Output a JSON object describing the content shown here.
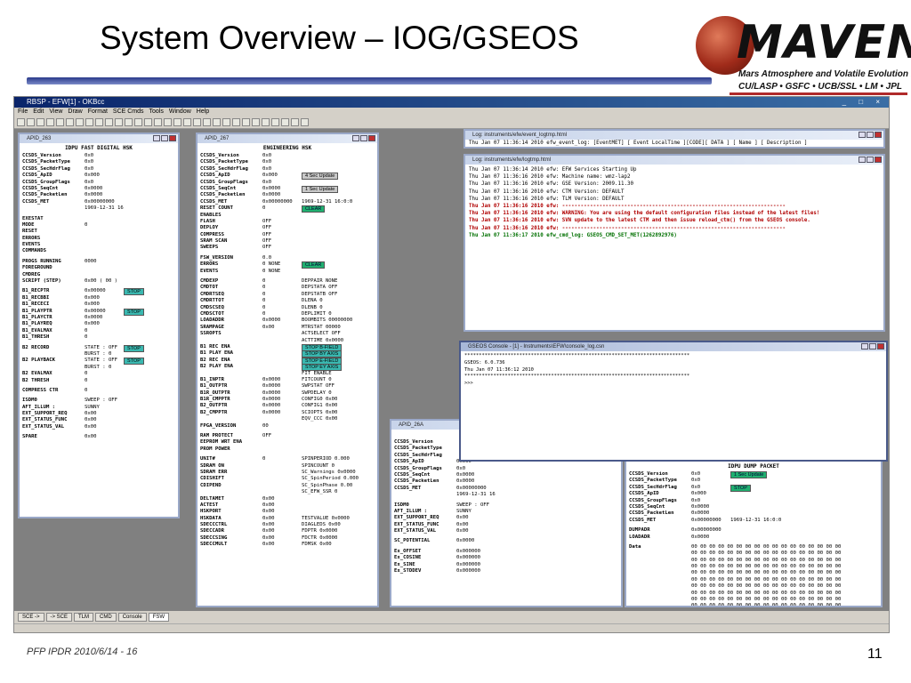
{
  "slide": {
    "title": "System Overview – IOG/GSEOS",
    "footer": "PFP IPDR 2010/6/14 - 16",
    "page_number": "11",
    "logo": {
      "word": "MAVEN",
      "subtitle": "Mars Atmosphere and Volatile Evolution Mission",
      "partners": "CU/LASP • GSFC • UCB/SSL • LM • JPL"
    }
  },
  "app": {
    "title": "RBSP - EFW[1] - OKBcc",
    "window_controls": "_ □ ×",
    "menu": [
      "File",
      "Edit",
      "View",
      "Draw",
      "Format",
      "SCE Cmds",
      "Tools",
      "Window",
      "Help"
    ],
    "toolbar_count": 30,
    "tasks": [
      "SCE ->",
      "-> SCE",
      "TLM",
      "CMD",
      "Console",
      "FSW"
    ],
    "active_task": "FSW"
  },
  "apid263": {
    "title": "APID_263",
    "header": "IDPU FAST DIGITAL HSK",
    "ccsds": [
      {
        "label": "CCSDS_Version",
        "value": "0x0"
      },
      {
        "label": "CCSDS_PacketType",
        "value": "0x0"
      },
      {
        "label": "CCSDS_SecHdrFlag",
        "value": "0x0"
      },
      {
        "label": "CCSDS_ApID",
        "value": "0x000"
      },
      {
        "label": "CCSDS_GroupFlags",
        "value": "0x0"
      },
      {
        "label": "CCSDS_SeqCnt",
        "value": "0x0000"
      },
      {
        "label": "CCSDS_PacketLen",
        "value": "0x0000"
      },
      {
        "label": "CCSDS_MET",
        "value": "0x00000000"
      }
    ],
    "met_time": "1969-12-31 16:0:0",
    "exestat_label": "EXESTAT",
    "exestat": [
      {
        "label": "MODE",
        "value": "0"
      },
      {
        "label": "RESET",
        "value": ""
      },
      {
        "label": "ERRORS",
        "value": ""
      },
      {
        "label": "EVENTS",
        "value": ""
      },
      {
        "label": "COMMANDS",
        "value": ""
      }
    ],
    "progs": [
      {
        "label": "PROGS RUNNING",
        "value": "0000"
      },
      {
        "label": "FOREGROUND",
        "value": ""
      },
      {
        "label": "CMDREG",
        "value": ""
      },
      {
        "label": "SCRIPT (STEP)",
        "value": "0x00 ( 00 )"
      }
    ],
    "b1": [
      {
        "label": "B1_RECPTR",
        "value": "0x00000",
        "btn": "STOP"
      },
      {
        "label": "B1_RECBBI",
        "value": "0x000",
        "btn": ""
      },
      {
        "label": "B1_RECECI",
        "value": "0x000",
        "btn": ""
      },
      {
        "label": "B1_PLAYPTR",
        "value": "0x00000",
        "btn": "STOP"
      },
      {
        "label": "B1_PLAYCTR",
        "value": "0x0000",
        "btn": ""
      },
      {
        "label": "B1_PLAYREQ",
        "value": "0x000",
        "btn": ""
      },
      {
        "label": "B1_EVALMAX",
        "value": "0",
        "btn": ""
      },
      {
        "label": "B1_THRESH",
        "value": "0",
        "btn": ""
      }
    ],
    "b2_record": {
      "label": "B2 RECORD",
      "state": "STATE : OFF",
      "burst": "BURST : 0",
      "btn": "STOP"
    },
    "b2_playback": {
      "label": "B2 PLAYBACK",
      "state": "STATE : OFF",
      "burst": "BURST : 0",
      "btn": "STOP"
    },
    "b2_other": [
      {
        "label": "B2 EVALMAX",
        "value": "0"
      },
      {
        "label": "B2 THRESH",
        "value": "0"
      }
    ],
    "compress_ctr": {
      "label": "COMPRESS CTR",
      "value": "0"
    },
    "isdm": [
      {
        "label": "ISDM0",
        "sub": "SWEEP :",
        "value": "OFF"
      },
      {
        "label": "",
        "sub": "AFT_ILLUM :",
        "value": "SUNNY"
      },
      {
        "label": "EXT_SUPPORT_REQ",
        "sub": "",
        "value": "0x00"
      },
      {
        "label": "EXT_STATUS_FUNC",
        "sub": "",
        "value": "0x00"
      },
      {
        "label": "EXT_STATUS_VAL",
        "sub": "",
        "value": "0x00"
      }
    ],
    "spare": {
      "label": "SPARE",
      "value": "0x00"
    }
  },
  "apid267": {
    "title": "APID_267",
    "header": "ENGINEERING HSK",
    "ccsds": [
      {
        "label": "CCSDS_Version",
        "value": "0x0",
        "btn": ""
      },
      {
        "label": "CCSDS_PacketType",
        "value": "0x0",
        "btn": ""
      },
      {
        "label": "CCSDS_SecHdrFlag",
        "value": "0x0",
        "btn": ""
      },
      {
        "label": "CCSDS_ApID",
        "value": "0x000",
        "btn": "4 Sec Update"
      },
      {
        "label": "CCSDS_GroupFlags",
        "value": "0x0",
        "btn": ""
      },
      {
        "label": "CCSDS_SeqCnt",
        "value": "0x0000",
        "btn": "1 Sec Update"
      },
      {
        "label": "CCSDS_PacketLen",
        "value": "0x0000",
        "btn": ""
      },
      {
        "label": "CCSDS_MET",
        "value": "0x00000000",
        "btn": "1969-12-31 16:0:0"
      }
    ],
    "reset_count": {
      "label": "RESET COUNT",
      "value": "0",
      "btn": "CLEAR"
    },
    "enables_label": "ENABLES",
    "enables": [
      {
        "label": "FLASH",
        "value": "OFF"
      },
      {
        "label": "DEPLOY",
        "value": "OFF"
      },
      {
        "label": "COMPRESS",
        "value": "OFF"
      },
      {
        "label": "SRAM SCAN",
        "value": "OFF"
      },
      {
        "label": "SWEEPS",
        "value": "OFF"
      }
    ],
    "fsw_version": {
      "label": "FSW_VERSION",
      "value": "0.0"
    },
    "errors": {
      "label": "ERRORS",
      "value": "0 NONE",
      "extra": "0x0000",
      "btn": "CLEAR"
    },
    "events": {
      "label": "EVENTS",
      "value": "0 NONE"
    },
    "left_list": [
      {
        "label": "CMDEXP",
        "value": "0"
      },
      {
        "label": "CMDTOT",
        "value": "0"
      },
      {
        "label": "CMDRTSEQ",
        "value": "0"
      },
      {
        "label": "CMDRTTOT",
        "value": "0"
      },
      {
        "label": "CMDSCSEQ",
        "value": "0"
      },
      {
        "label": "CMDSCTOT",
        "value": "0"
      },
      {
        "label": "LOADADDR",
        "value": "0x0000"
      },
      {
        "label": "SRAMPAGE",
        "value": "0x00"
      },
      {
        "label": "SSROPTS",
        "value": ""
      }
    ],
    "right_list": [
      {
        "label": "DEPPAIR",
        "value": "NONE"
      },
      {
        "label": "DEPSTATA",
        "value": "OFF"
      },
      {
        "label": "DEPSTATB",
        "value": "OFF"
      },
      {
        "label": "DLENA",
        "value": "0"
      },
      {
        "label": "DLENB",
        "value": "0"
      },
      {
        "label": "DEPLIMIT",
        "value": "0"
      },
      {
        "label": "BOOMBITS",
        "value": "00000000"
      },
      {
        "label": "MTRSTAT",
        "value": "00000"
      },
      {
        "label": "ACTSELECT",
        "value": "OFF"
      },
      {
        "label": "ACTTIME",
        "value": "0x0000"
      }
    ],
    "ssropts": [
      {
        "label": "B1 REC ENA",
        "value": "STOP"
      },
      {
        "label": "B1 PLAY ENA",
        "value": "STOP"
      },
      {
        "label": "B2 REC ENA",
        "value": "STOP"
      },
      {
        "label": "B2 PLAY ENA",
        "value": "STOP"
      }
    ],
    "fit": {
      "label": "FIT ENABLE",
      "items": [
        "B-FIELD",
        "BY AXIS",
        "E-FIELD",
        "EY AXIS"
      ]
    },
    "ptrs": [
      {
        "label": "B1_INPTR",
        "value": "0x0000"
      },
      {
        "label": "B1_OUTPTR",
        "value": "0x0000"
      },
      {
        "label": "B1R_OUTPTR",
        "value": "0x0000"
      },
      {
        "label": "B1R_CMPPTR",
        "value": "0x0000"
      },
      {
        "label": "B2_OUTPTR",
        "value": "0x0000"
      },
      {
        "label": "B2_CMPPTR",
        "value": "0x0000"
      }
    ],
    "fit_right": [
      {
        "label": "FITCOUNT",
        "value": "0"
      },
      {
        "label": "SWPSTAT",
        "value": "OFF"
      },
      {
        "label": "SWPDELAY",
        "value": "0"
      },
      {
        "label": "CONFIG0",
        "value": "0x00"
      },
      {
        "label": "CONFIG1",
        "value": "0x00"
      },
      {
        "label": "SCIOPTS",
        "value": "0x00"
      },
      {
        "label": "EQV_CCC",
        "value": "0x00"
      }
    ],
    "fpga_version": {
      "label": "FPGA_VERSION",
      "value": "00"
    },
    "ram_protect": [
      {
        "label": "RAM PROTECT",
        "value": "OFF"
      },
      {
        "label": "EEPROM WRT ENA",
        "value": ""
      },
      {
        "label": "PROM POWER",
        "value": ""
      }
    ],
    "unit": [
      {
        "label": "UNIT#",
        "value": "0"
      },
      {
        "label": "SDRAM ON",
        "value": ""
      },
      {
        "label": "SDRAM ERR",
        "value": ""
      },
      {
        "label": "CDISHIFT",
        "value": ""
      },
      {
        "label": "CDIPEND",
        "value": ""
      }
    ],
    "spin": [
      {
        "label": "SPINPERIOD",
        "value": "0.000"
      },
      {
        "label": "SPINCOUNT",
        "value": "0"
      },
      {
        "label": "SC_Warnings",
        "value": "0x0000"
      },
      {
        "label": "SC_SpinPeriod",
        "value": "0.000"
      },
      {
        "label": "SC_SpinPhase",
        "value": "0.00"
      },
      {
        "label": "SC_EFW_SSR",
        "value": "0"
      }
    ],
    "misc_left": [
      {
        "label": "DELTAMET",
        "value": "0x00"
      },
      {
        "label": "ACTEST",
        "value": "0x00"
      },
      {
        "label": "HSKPORT",
        "value": "0x00"
      },
      {
        "label": "HSKDATA",
        "value": "0x00"
      },
      {
        "label": "SDECCCTRL",
        "value": "0x00"
      },
      {
        "label": "SDECCADR",
        "value": "0x00"
      },
      {
        "label": "SDECCSING",
        "value": "0x00"
      },
      {
        "label": "SDECCMULT",
        "value": "0x00"
      }
    ],
    "misc_right": [
      {
        "label": "",
        "value": ""
      },
      {
        "label": "",
        "value": ""
      },
      {
        "label": "",
        "value": ""
      },
      {
        "label": "TESTVALUE",
        "value": "0x0000"
      },
      {
        "label": "DIAGLEDS",
        "value": "0x00"
      },
      {
        "label": "FDPTR",
        "value": "0x0000"
      },
      {
        "label": "FDCTR",
        "value": "0x0000"
      },
      {
        "label": "FDMSK",
        "value": "0x00"
      }
    ]
  },
  "log_event": {
    "title": "Log: instruments/efw/event_logtmp.html",
    "header": "Thu Jan 07 11:36:14 2010 efw_event_log: [EventMET] [ Event LocalTime ][CODE][ DATA ] [ Name  ] [ Description ]"
  },
  "log_main": {
    "title": "Log: instruments/efw/logtmp.html",
    "lines": [
      {
        "text": "Thu Jan 07 11:36:14 2010 efw: EFW Services Starting Up",
        "style": "normal"
      },
      {
        "text": "Thu Jan 07 11:36:16 2010 efw: Machine name: wmz-lap2",
        "style": "normal"
      },
      {
        "text": "Thu Jan 07 11:36:16 2010 efw: GSE Version:  2009.11.30",
        "style": "normal"
      },
      {
        "text": "Thu Jan 07 11:36:16 2010 efw: CTM Version:  DEFAULT",
        "style": "normal"
      },
      {
        "text": "Thu Jan 07 11:36:16 2010 efw: TLM Version:  DEFAULT",
        "style": "normal"
      },
      {
        "text": "Thu Jan 07 11:36:16 2010 efw: ------------------------------------------------------------------------",
        "style": "red"
      },
      {
        "text": "Thu Jan 07 11:36:16 2010 efw: WARNING: You are using the default configuration files instead of the latest files!",
        "style": "red"
      },
      {
        "text": "Thu Jan 07 11:36:16 2010 efw: SVN update to the latest CTM and then issue reload_ctm() from the GSEOS console.",
        "style": "red"
      },
      {
        "text": "Thu Jan 07 11:36:16 2010 efw: ------------------------------------------------------------------------",
        "style": "red"
      },
      {
        "text": "Thu Jan 07 11:36:17 2010 efw_cmd_log: GSEOS_CMD_SET_MET(1262892976)",
        "style": "green"
      }
    ]
  },
  "console": {
    "title": "GSEOS Console - [1] - Instruments\\EFW\\console_log.csn",
    "lines": [
      "******************************************************************************",
      "GSEOS: 6.0.736",
      "Thu Jan 07 11:36:12 2010",
      "******************************************************************************",
      ">>>"
    ]
  },
  "apid26a": {
    "title": "APID_26A",
    "header": "SPACE",
    "ccsds": [
      {
        "label": "CCSDS_Version",
        "value": ""
      },
      {
        "label": "CCSDS_PacketType",
        "value": ""
      },
      {
        "label": "CCSDS_SecHdrFlag",
        "value": ""
      },
      {
        "label": "CCSDS_ApID",
        "value": "0x000"
      },
      {
        "label": "CCSDS_GroupFlags",
        "value": "0x0"
      },
      {
        "label": "CCSDS_SeqCnt",
        "value": "0x0000"
      },
      {
        "label": "CCSDS_PacketLen",
        "value": "0x0000"
      },
      {
        "label": "CCSDS_MET",
        "value": "0x00000000"
      }
    ],
    "met_time": "1969-12-31 16:0:0",
    "isdm": [
      {
        "label": "ISDM0",
        "sub": "SWEEP :",
        "value": "OFF"
      },
      {
        "label": "",
        "sub": "AFT_ILLUM :",
        "value": "SUNNY"
      },
      {
        "label": "EXT_SUPPORT_REQ",
        "sub": "",
        "value": "0x00"
      },
      {
        "label": "EXT_STATUS_FUNC",
        "sub": "",
        "value": "0x00"
      },
      {
        "label": "EXT_STATUS_VAL",
        "sub": "",
        "value": "0x00"
      }
    ],
    "potential": {
      "label": "SC_POTENTIAL",
      "value": "0x0000"
    },
    "ex": [
      {
        "label": "Ex_OFFSET",
        "value": "0x000000"
      },
      {
        "label": "Ex_COSINE",
        "value": "0x000000"
      },
      {
        "label": "Ex_SINE",
        "value": "0x000000"
      },
      {
        "label": "Ex_STDDEV",
        "value": "0x000000"
      }
    ]
  },
  "dump": {
    "title": "",
    "header": "IDPU DUMP PACKET",
    "ccsds": [
      {
        "label": "CCSDS_Version",
        "value": "0x0",
        "btn": "1 Sec Update"
      },
      {
        "label": "CCSDS_PacketType",
        "value": "0x0",
        "btn": ""
      },
      {
        "label": "CCSDS_SecHdrFlag",
        "value": "0x0",
        "btn": "STOP"
      },
      {
        "label": "CCSDS_ApID",
        "value": "0x000",
        "btn": ""
      },
      {
        "label": "CCSDS_GroupFlags",
        "value": "0x0",
        "btn": ""
      },
      {
        "label": "CCSDS_SeqCnt",
        "value": "0x0000",
        "btn": ""
      },
      {
        "label": "CCSDS_PacketLen",
        "value": "0x0000",
        "btn": ""
      },
      {
        "label": "CCSDS_MET",
        "value": "0x00000000",
        "btn": "1969-12-31 16:0:0"
      }
    ],
    "dumpadr": {
      "label": "DUMPADR",
      "value": "0x00000000"
    },
    "loadadr": {
      "label": "LOADADR",
      "value": "0x0000"
    },
    "data_label": "Data",
    "data_row": "00 00 00 00 00 00 00 00 00 00 00 00 00 00 00 00 00",
    "data_rows": 10
  }
}
